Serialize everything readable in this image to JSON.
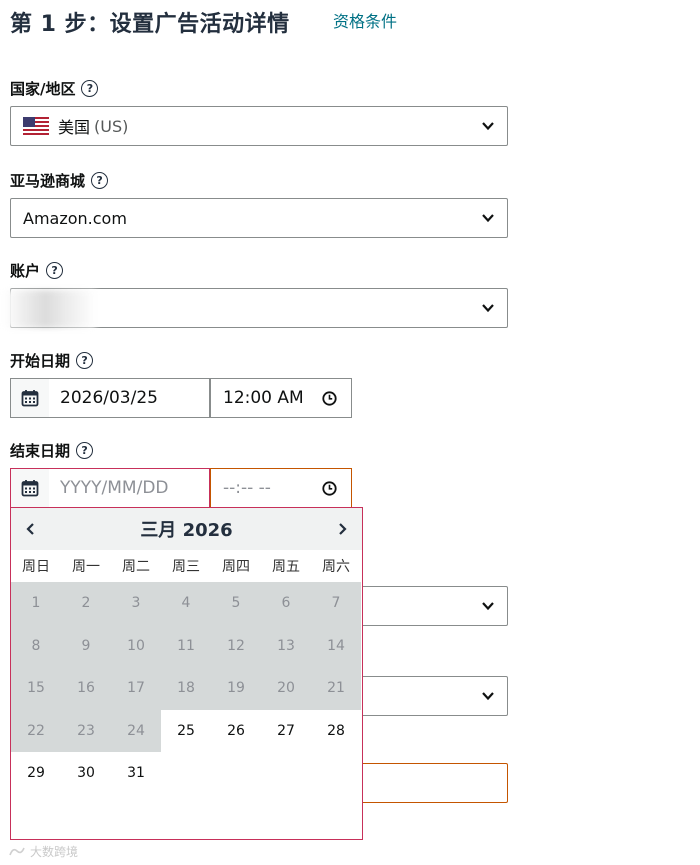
{
  "header": {
    "title": "第 1 步：设置广告活动详情",
    "eligibility_link": "资格条件"
  },
  "form": {
    "country": {
      "label": "国家/地区",
      "value_name": "美国",
      "value_code": "(US)"
    },
    "marketplace": {
      "label": "亚马逊商城",
      "value": "Amazon.com"
    },
    "account": {
      "label": "账户",
      "value": ""
    },
    "start": {
      "label": "开始日期",
      "date": "2026/03/25",
      "time": "12:00 AM"
    },
    "end": {
      "label": "结束日期",
      "date_placeholder": "YYYY/MM/DD",
      "time_placeholder": "--:-- --"
    }
  },
  "calendar": {
    "month_label": "三月 2026",
    "weekdays": [
      "周日",
      "周一",
      "周二",
      "周三",
      "周四",
      "周五",
      "周六"
    ],
    "first_weekday_index": 0,
    "days_in_month": 31,
    "first_enabled_day": 25
  },
  "watermark": "大数跨境",
  "help_glyph": "?",
  "icons": {
    "flag": "us-flag-icon",
    "chevron": "chevron-down-icon",
    "calendar": "calendar-icon",
    "clock": "clock-icon",
    "prev": "chevron-left-icon",
    "next": "chevron-right-icon"
  },
  "colors": {
    "link": "#007185",
    "error_border": "#c7305a",
    "disabled_day_bg": "#d5d9d9",
    "title": "#232f3e"
  }
}
